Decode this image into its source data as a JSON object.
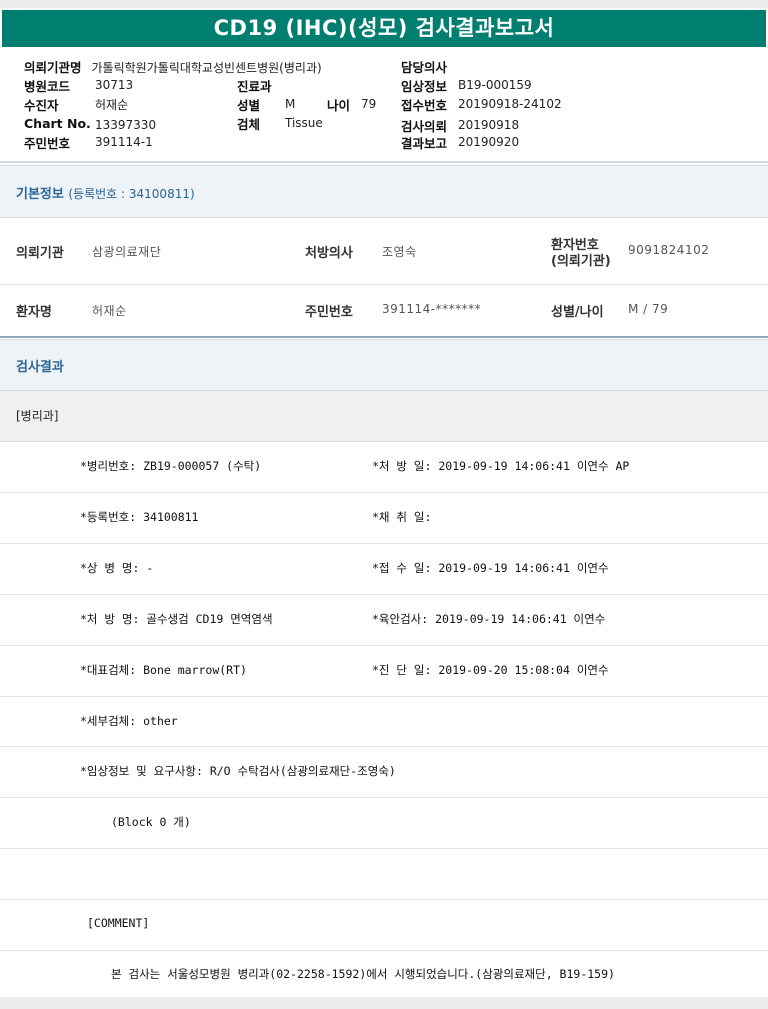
{
  "title": "CD19 (IHC)(성모) 검사결과보고서",
  "header": {
    "requesting_org_label": "의뢰기관명",
    "requesting_org_value": "가톨릭학원가톨릭대학교성빈센트병원(병리과)",
    "hospital_code_label": "병원코드",
    "hospital_code_value": "30713",
    "patient_label": "수진자",
    "patient_value": "허재순",
    "chart_label": "Chart No.",
    "chart_value": "13397330",
    "resident_label": "주민번호",
    "resident_value": "391114-1",
    "dept_label": "진료과",
    "dept_value": "",
    "sex_label": "성별",
    "sex_value": "M",
    "age_label": "나이",
    "age_value": "79",
    "specimen_label": "검체",
    "specimen_value": "Tissue",
    "doctor_label": "담당의사",
    "doctor_value": "",
    "clinical_label": "임상정보",
    "clinical_value": "B19-000159",
    "receipt_label": "접수번호",
    "receipt_value": "20190918-24102",
    "request_label": "검사의뢰",
    "request_value": "20190918",
    "report_label": "결과보고",
    "report_value": "20190920"
  },
  "basic": {
    "title": "기본정보",
    "reg": "(등록번호 : 34100811)",
    "org_label": "의뢰기관",
    "org_value": "삼광의료재단",
    "prescriber_label": "처방의사",
    "prescriber_value": "조영숙",
    "ptno_label_1": "환자번호",
    "ptno_label_2": "(의뢰기관)",
    "ptno_value": "9091824102",
    "name_label": "환자명",
    "name_value": "허재순",
    "resident_label": "주민번호",
    "resident_value": "391114-*******",
    "sexage_label": "성별/나이",
    "sexage_value": "M / 79"
  },
  "results": {
    "title": "검사결과",
    "dept": "[병리과]",
    "rows": [
      {
        "left": "*병리번호: ZB19-000057 (수탁)",
        "right": "*처 방 일: 2019-09-19 14:06:41  이연수 AP"
      },
      {
        "left": "*등록번호: 34100811",
        "right": "*채 취 일:"
      },
      {
        "left": "*상 병 명: -",
        "right": "*접 수 일: 2019-09-19 14:06:41  이연수"
      },
      {
        "left": "*처 방 명: 골수생검 CD19 면역염색",
        "right": "*육안검사: 2019-09-19 14:06:41  이연수"
      },
      {
        "left": "*대표검체: Bone marrow(RT)",
        "right": "*진 단 일: 2019-09-20 15:08:04  이연수"
      },
      {
        "left": "*세부검체: other",
        "right": ""
      },
      {
        "left": "*임상정보 및 요구사항: R/O 수탁검사(삼광의료재단-조영숙)",
        "right": ""
      }
    ],
    "block": "(Block 0 개)",
    "comment": "[COMMENT]",
    "note": "본 검사는 서울성모병원 병리과(02-2258-1592)에서 시행되었습니다.(삼광의료재단, B19-159)"
  }
}
